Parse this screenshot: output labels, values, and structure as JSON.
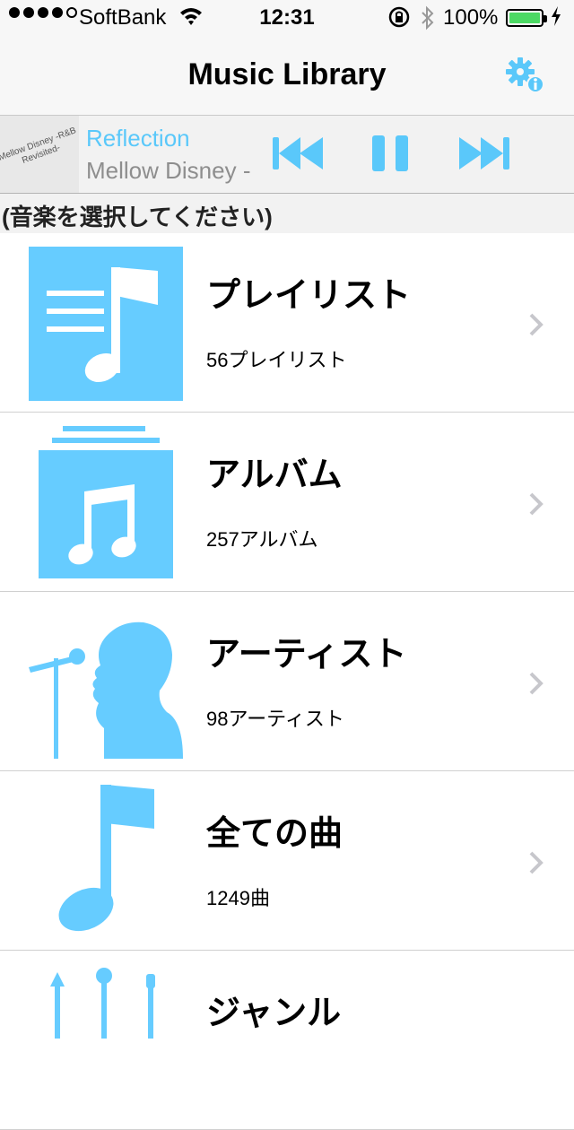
{
  "status_bar": {
    "carrier": "SoftBank",
    "time": "12:31",
    "battery": "100%",
    "signal_dots": 4,
    "signal_total": 5,
    "battery_color": "#4cd964"
  },
  "nav": {
    "title": "Music Library",
    "settings_icon": "gear-info-icon"
  },
  "now_playing": {
    "artwork_text": "Mellow Disney -R&B Revisited-",
    "title": "Reflection",
    "artist": "Mellow Disney -",
    "controls": [
      "previous-icon",
      "pause-icon",
      "next-icon"
    ]
  },
  "section_header": "(音楽を選択してください)",
  "menu": [
    {
      "title": "プレイリスト",
      "count": "56プレイリスト",
      "icon": "playlist-icon"
    },
    {
      "title": "アルバム",
      "count": "257アルバム",
      "icon": "album-icon"
    },
    {
      "title": "アーティスト",
      "count": "98アーティスト",
      "icon": "artist-icon"
    },
    {
      "title": "全ての曲",
      "count": "1249曲",
      "icon": "song-icon"
    },
    {
      "title": "ジャンル",
      "count": "",
      "icon": "genre-icon"
    }
  ],
  "colors": {
    "accent": "#5ac8fa",
    "icon_blue": "#66ccff",
    "chevron": "#c7c7cc"
  }
}
